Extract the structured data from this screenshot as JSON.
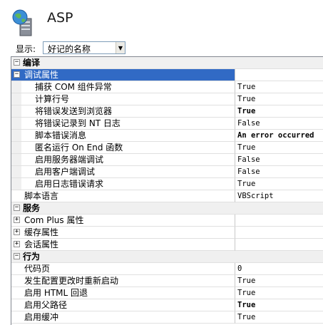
{
  "header": {
    "title": "ASP"
  },
  "display": {
    "label": "显示:",
    "selected": "好记的名称"
  },
  "categories": [
    {
      "label": "编译",
      "expanded": true
    },
    {
      "label": "服务",
      "expanded": true
    },
    {
      "label": "行为",
      "expanded": true
    }
  ],
  "compile": {
    "debug_group": "调试属性",
    "debug_items": [
      {
        "name": "捕获 COM 组件异常",
        "value": "True"
      },
      {
        "name": "计算行号",
        "value": "True"
      },
      {
        "name": "将错误发送到浏览器",
        "value": "True",
        "bold": true
      },
      {
        "name": "将错误记录到 NT 日志",
        "value": "False"
      },
      {
        "name": "脚本错误消息",
        "value": "An error occurred",
        "bold": true
      },
      {
        "name": "匿名运行 On End 函数",
        "value": "True"
      },
      {
        "name": "启用服务器端调试",
        "value": "False"
      },
      {
        "name": "启用客户端调试",
        "value": "False"
      },
      {
        "name": "启用日志错误请求",
        "value": "True"
      }
    ],
    "script_lang": {
      "name": "脚本语言",
      "value": "VBScript"
    }
  },
  "services": {
    "items": [
      "Com Plus 属性",
      "缓存属性",
      "会话属性"
    ]
  },
  "behavior": {
    "items": [
      {
        "name": "代码页",
        "value": "0"
      },
      {
        "name": "发生配置更改时重新启动",
        "value": "True"
      },
      {
        "name": "启用 HTML 回退",
        "value": "True"
      },
      {
        "name": "启用父路径",
        "value": "True",
        "bold": true
      },
      {
        "name": "启用缓冲",
        "value": "True"
      }
    ]
  }
}
